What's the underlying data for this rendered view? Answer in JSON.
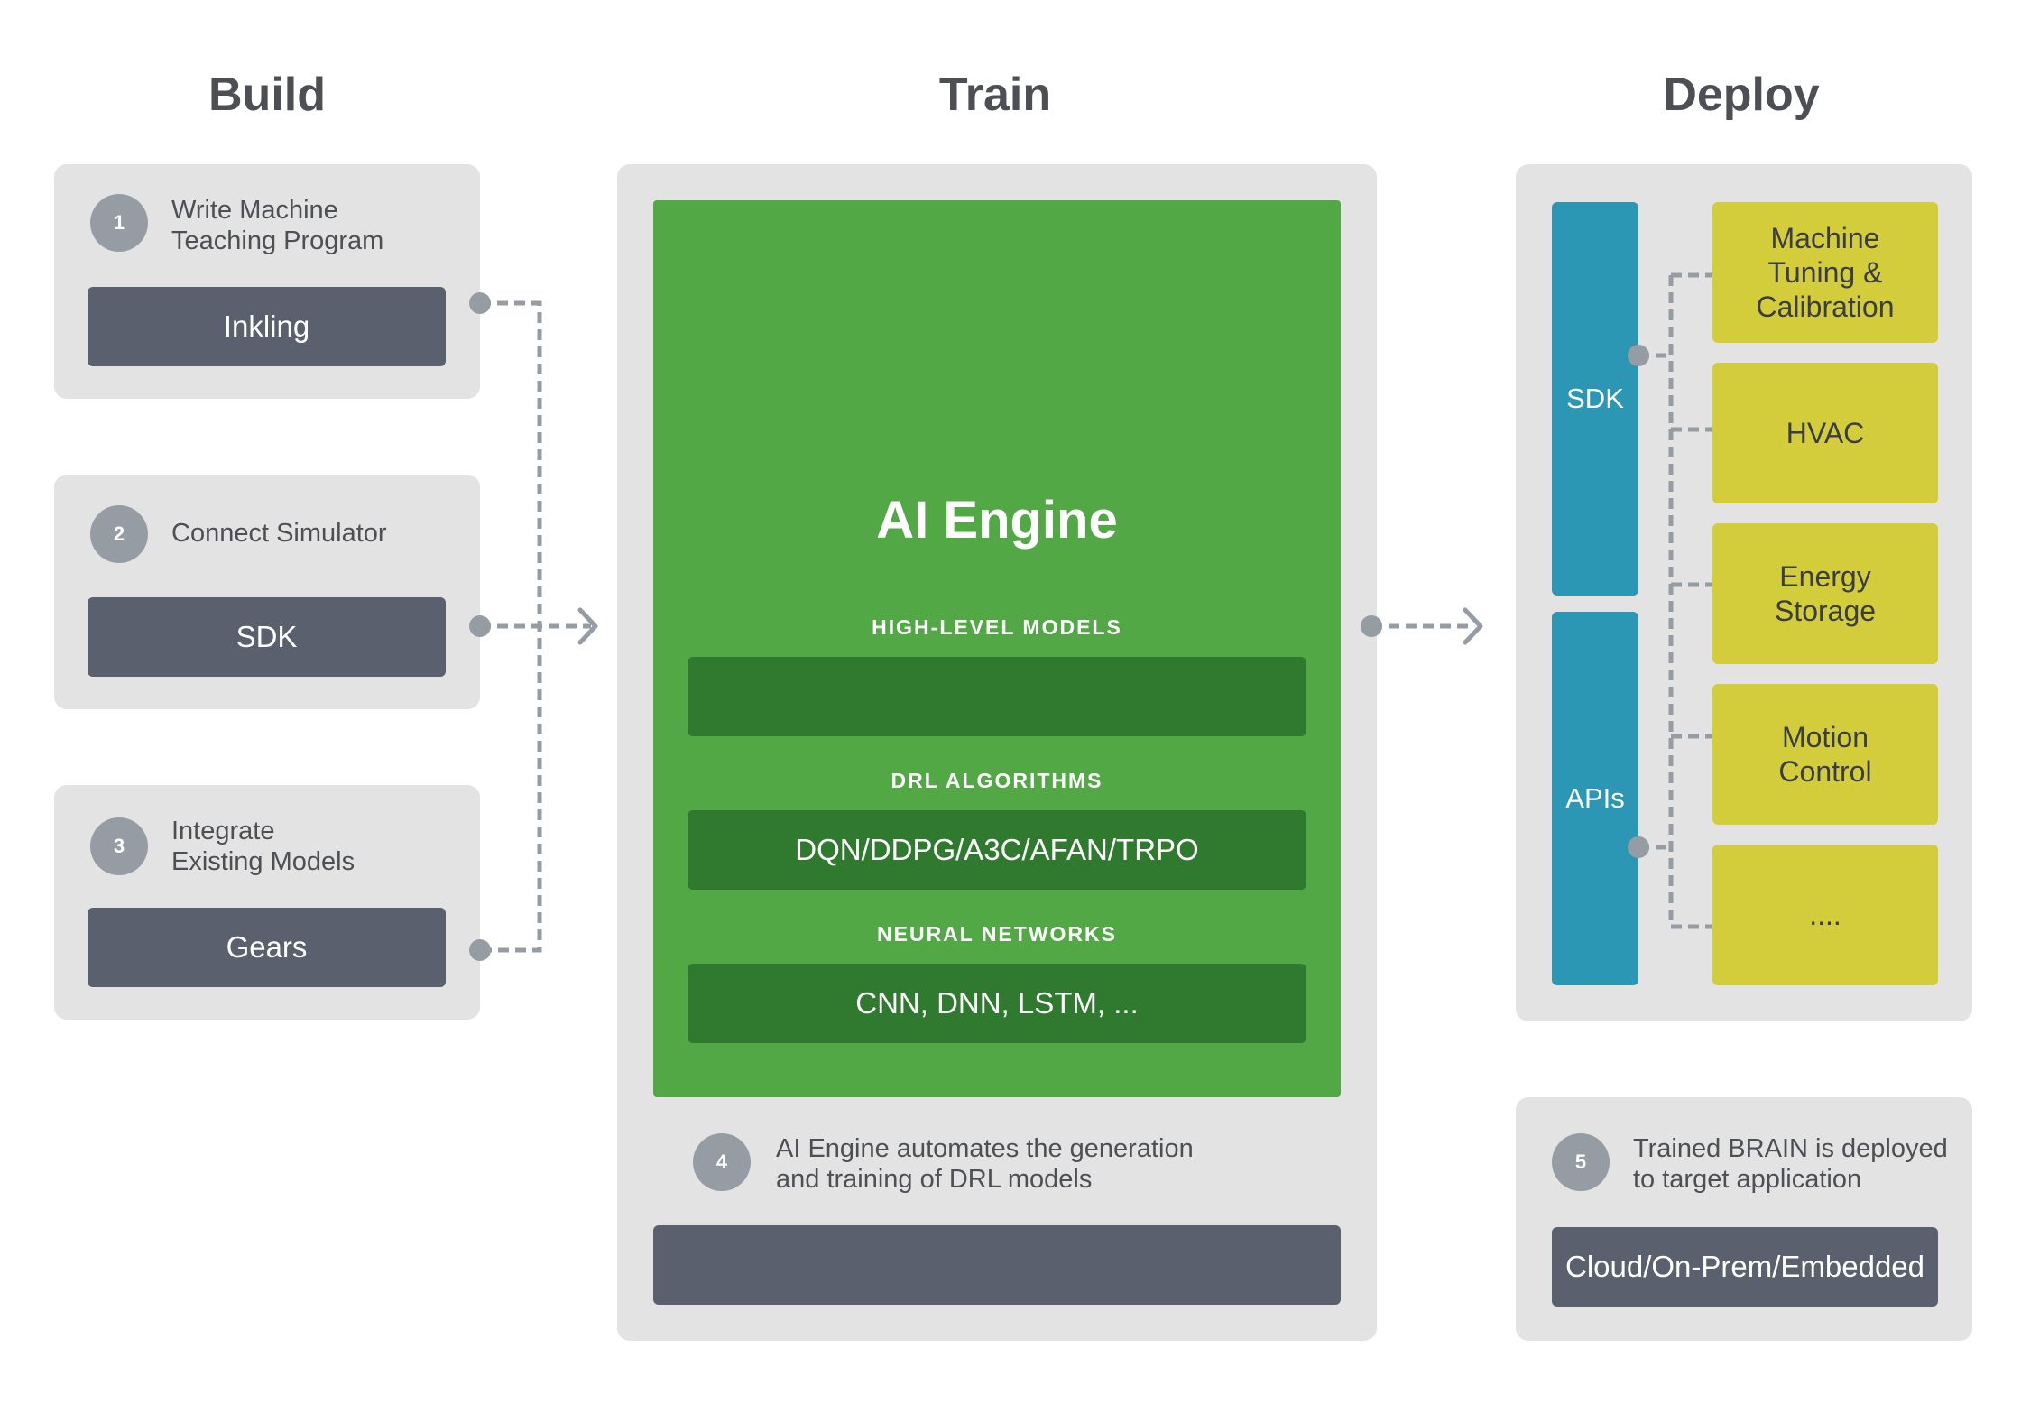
{
  "columns": {
    "build": "Build",
    "train": "Train",
    "deploy": "Deploy"
  },
  "build": {
    "steps": [
      {
        "number": "1",
        "text": "Write Machine\nTeaching Program",
        "tool": "Inkling"
      },
      {
        "number": "2",
        "text": "Connect Simulator",
        "tool": "SDK"
      },
      {
        "number": "3",
        "text": "Integrate\nExisting Models",
        "tool": "Gears"
      }
    ]
  },
  "train": {
    "engine_title": "AI Engine",
    "sections": [
      {
        "label": "HIGH-LEVEL MODELS",
        "content": ""
      },
      {
        "label": "DRL ALGORITHMS",
        "content": "DQN/DDPG/A3C/AFAN/TRPO"
      },
      {
        "label": "NEURAL NETWORKS",
        "content": "CNN, DNN, LSTM, ..."
      }
    ],
    "step": {
      "number": "4",
      "text": "AI Engine automates the generation\nand training of DRL models"
    },
    "bottom_bar": ""
  },
  "deploy": {
    "interfaces": [
      "SDK",
      "APIs"
    ],
    "targets": [
      "Machine\nTuning &\nCalibration",
      "HVAC",
      "Energy\nStorage",
      "Motion\nControl",
      "...."
    ],
    "step": {
      "number": "5",
      "text": "Trained BRAIN is deployed\nto target application"
    },
    "platform": "Cloud/On-Prem/Embedded"
  },
  "colors": {
    "panel": "#e3e3e3",
    "dark_bar": "#5a606e",
    "badge": "#959ca3",
    "green_main": "#53a846",
    "green_dark": "#2f7a2e",
    "blue": "#2c96b5",
    "yellow": "#d3cd3b",
    "connector": "#959ca3"
  }
}
